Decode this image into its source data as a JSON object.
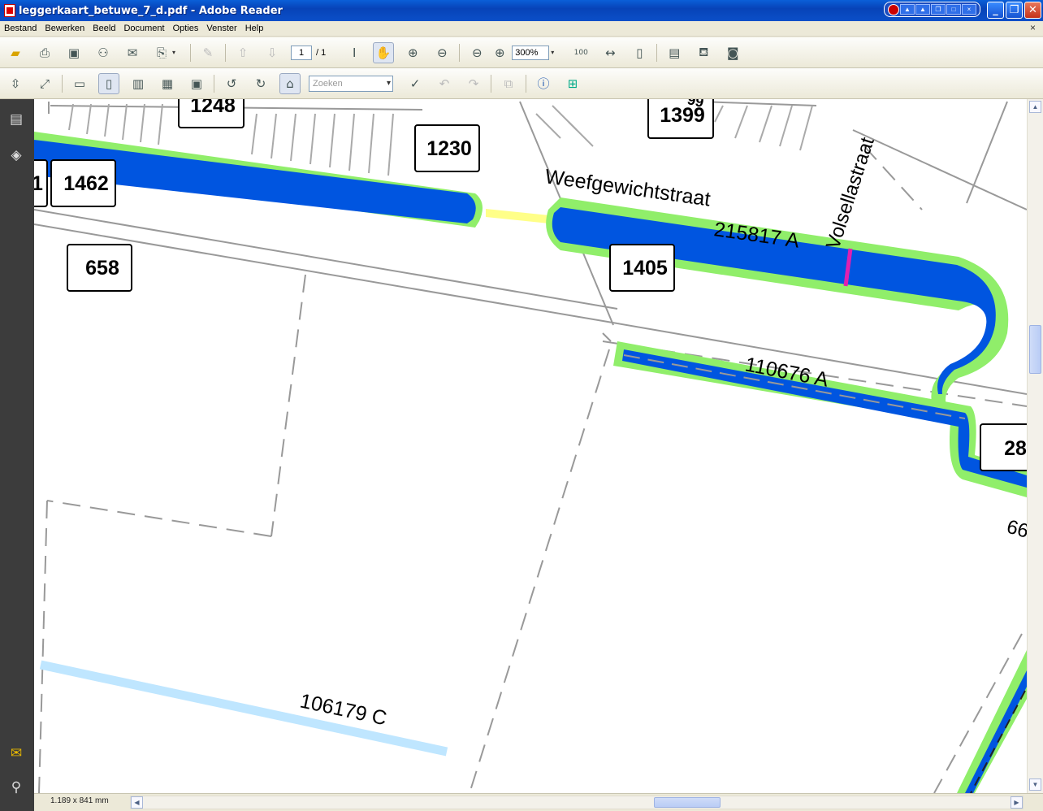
{
  "window": {
    "title": "leggerkaart_betuwe_7_d.pdf - Adobe Reader"
  },
  "menu": [
    "Bestand",
    "Bewerken",
    "Beeld",
    "Document",
    "Opties",
    "Venster",
    "Help"
  ],
  "toolbar": {
    "page_current": "1",
    "page_total": "/ 1",
    "zoom": "300%",
    "search_placeholder": "Zoeken"
  },
  "status": {
    "page_size": "1.189 x 841 mm"
  },
  "map": {
    "street_1": "Weefgewichtstraat",
    "street_2": "Volsellastraat",
    "watercourse_1": "215817 A",
    "watercourse_2": "110676 A",
    "watercourse_3": "106179 C",
    "parcels": [
      "1248",
      "1399",
      "1230",
      "1462",
      "1",
      "658",
      "1405",
      "28"
    ],
    "partial_label_top": "99",
    "partial_label_right": "66"
  },
  "colors": {
    "water": "#0055E0",
    "bank": "#90EE6A",
    "light_water": "#BFE6FF",
    "highlight": "#FFFF88",
    "culvert": "#E020B0"
  }
}
